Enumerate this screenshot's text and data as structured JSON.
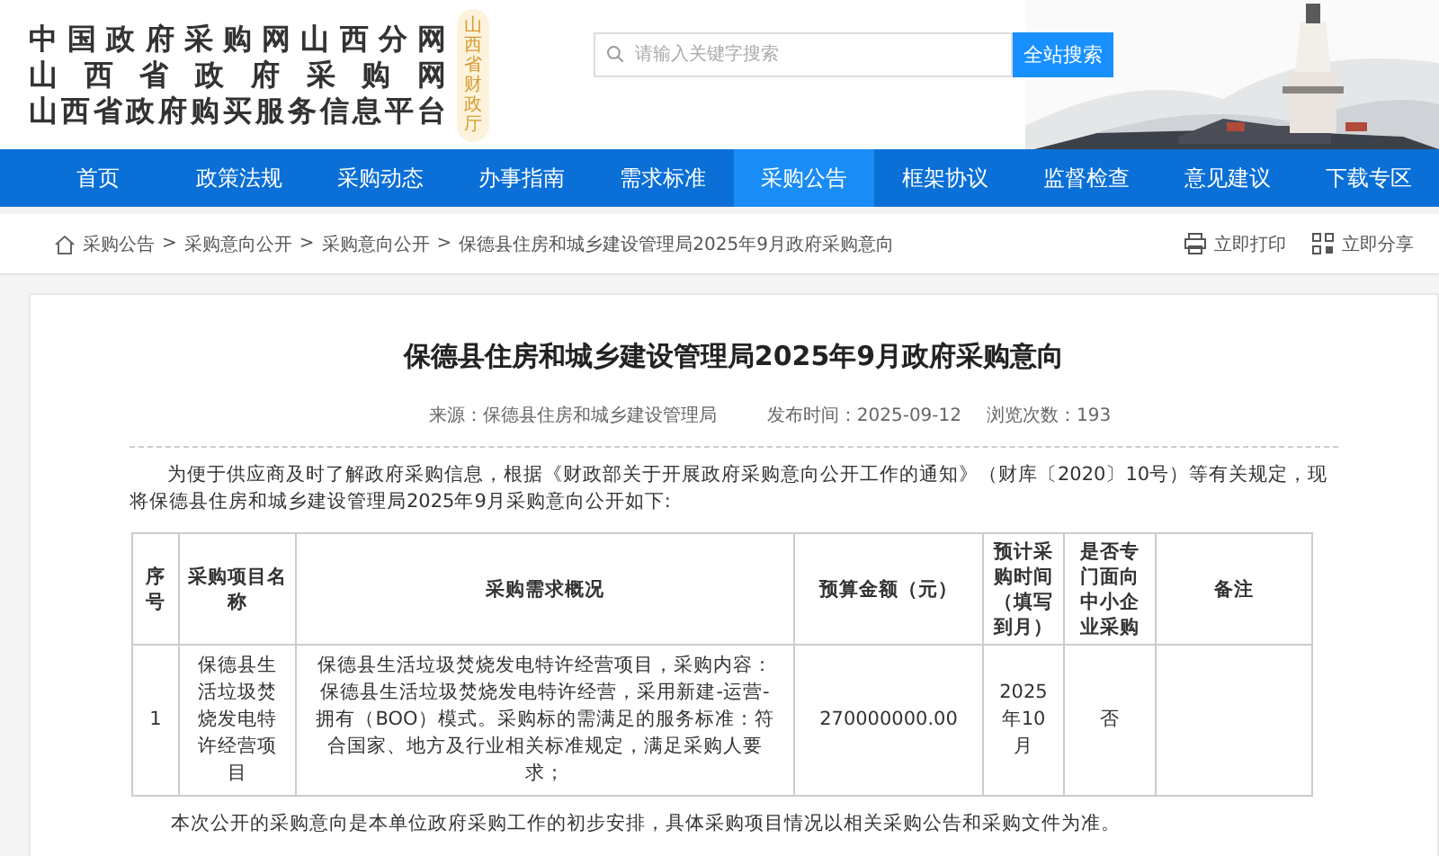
{
  "header": {
    "logo_lines": [
      "中国政府采购网山西分网",
      "山西省政府采购网",
      "山西省政府购买服务信息平台"
    ],
    "seal": "山西省财政厅",
    "search": {
      "placeholder": "请输入关键字搜索",
      "button": "全站搜索"
    }
  },
  "nav": [
    {
      "label": "首页",
      "selected": false
    },
    {
      "label": "政策法规",
      "selected": false
    },
    {
      "label": "采购动态",
      "selected": false
    },
    {
      "label": "办事指南",
      "selected": false
    },
    {
      "label": "需求标准",
      "selected": false
    },
    {
      "label": "采购公告",
      "selected": true
    },
    {
      "label": "框架协议",
      "selected": false
    },
    {
      "label": "监督检查",
      "selected": false
    },
    {
      "label": "意见建议",
      "selected": false
    },
    {
      "label": "下载专区",
      "selected": false
    }
  ],
  "breadcrumb": [
    {
      "label": "采购公告",
      "separator": ">"
    },
    {
      "label": "采购意向公开",
      "separator": ">"
    },
    {
      "label": "采购意向公开",
      "separator": ">"
    },
    {
      "label": "保德县住房和城乡建设管理局2025年9月政府采购意向"
    }
  ],
  "actions": [
    "立即打印",
    "立即分享"
  ],
  "article": {
    "title": "保德县住房和城乡建设管理局2025年9月政府采购意向",
    "source": "来源：保德县住房和城乡建设管理局",
    "published": "发布时间：2025-09-12",
    "views": "浏览次数：193",
    "intro": "为便于供应商及时了解政府采购信息，根据《财政部关于开展政府采购意向公开工作的通知》（财库〔2020〕10号）等有关规定，现将保德县住房和城乡建设管理局2025年9月采购意向公开如下:",
    "table": {
      "columns": [
        "序号",
        "采购项目名称",
        "采购需求概况",
        "预算金额（元）",
        "预计采购时间（填写到月）",
        "是否专门面向中小企业采购",
        "备注"
      ],
      "rows": [
        [
          "1",
          "保德县生活垃圾焚烧发电特许经营项目",
          "保德县生活垃圾焚烧发电特许经营项目，采购内容：保德县生活垃圾焚烧发电特许经营，采用新建-运营-拥有（BOO）模式。采购标的需满足的服务标准：符合国家、地方及行业相关标准规定，满足采购人要求；",
          "270000000.00",
          "2025年10月",
          "否",
          ""
        ]
      ]
    },
    "note": "本次公开的采购意向是本单位政府采购工作的初步安排，具体采购项目情况以相关采购公告和采购文件为准。"
  }
}
